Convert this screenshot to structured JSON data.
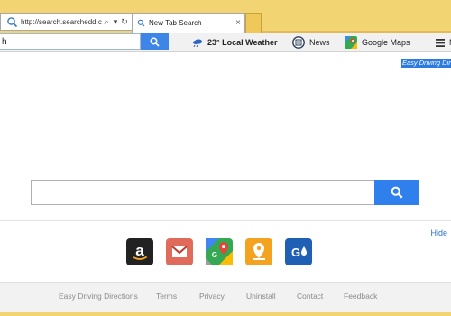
{
  "browser": {
    "address_url": "http://search.searchedd.c...",
    "tab_title": "New Tab Search",
    "tab_close": "×",
    "addr_search_glyph": "⌕",
    "addr_dropdown_glyph": "▾",
    "addr_refresh_glyph": "↻"
  },
  "toolbar": {
    "search_value": "h",
    "weather_label": "23° Local Weather",
    "news_label": "News",
    "maps_label": "Google Maps",
    "menu_label": "N"
  },
  "page": {
    "promo_text": "Easy Driving Directions",
    "search_value": "",
    "hide_label": "Hide",
    "tiles": [
      {
        "name": "amazon",
        "color": "#222222"
      },
      {
        "name": "gmail",
        "color": "#e06b5a"
      },
      {
        "name": "google-maps",
        "color": "#ffffff"
      },
      {
        "name": "directions",
        "color": "#f4a321"
      },
      {
        "name": "gas",
        "color": "#1f5fb4"
      }
    ]
  },
  "footer": {
    "links": [
      "Easy Driving Directions",
      "Terms",
      "Privacy",
      "Uninstall",
      "Contact",
      "Feedback"
    ]
  },
  "colors": {
    "chrome": "#f3d472",
    "search_button": "#2f80ed",
    "link": "#2a6fc9"
  }
}
